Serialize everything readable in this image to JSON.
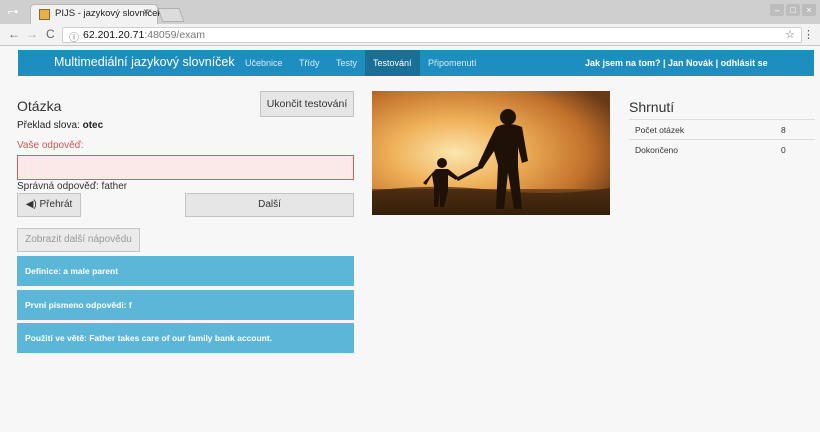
{
  "browser": {
    "tab_title": "PIJS - jazykový slovníček",
    "tab_close": "×",
    "url_host": "62.201.20.71",
    "url_path": ":48059/exam",
    "info_icon": "info-icon",
    "back": "←",
    "forward": "→",
    "reload": "C",
    "star": "☆",
    "menu": "⋮"
  },
  "navbar": {
    "brand": "Multimediální jazykový slovníček",
    "links": [
      "Učebnice",
      "Třídy",
      "Testy",
      "Testování",
      "Připomenutí"
    ],
    "active": "Testování",
    "user_text": "Jak jsem na tom? | Jan Novák | odhlásit se"
  },
  "question": {
    "heading": "Otázka",
    "end_button": "Ukončit testování",
    "translate_prefix": "Překlad slova:",
    "word": "otec",
    "answer_label": "Vaše odpověď:",
    "answer_value": "",
    "correct_text": "Správná odpověď: father",
    "play_button": "◀) Přehrát",
    "next_button": "Další",
    "hint_button": "Zobrazit další nápovědu",
    "hints": [
      "Definice: a male parent",
      "První písmeno odpovědi: f",
      "Použití ve větě: Father takes care of our family bank account."
    ]
  },
  "summary": {
    "heading": "Shrnutí",
    "rows": [
      {
        "label": "Počet otázek",
        "value": "8"
      },
      {
        "label": "Dokončeno",
        "value": "0"
      }
    ]
  },
  "colors": {
    "navbar": "#1e8ec0",
    "navbar_active": "#1a6f97",
    "hint_bg": "#5bb6d8",
    "error": "#d9534f"
  }
}
